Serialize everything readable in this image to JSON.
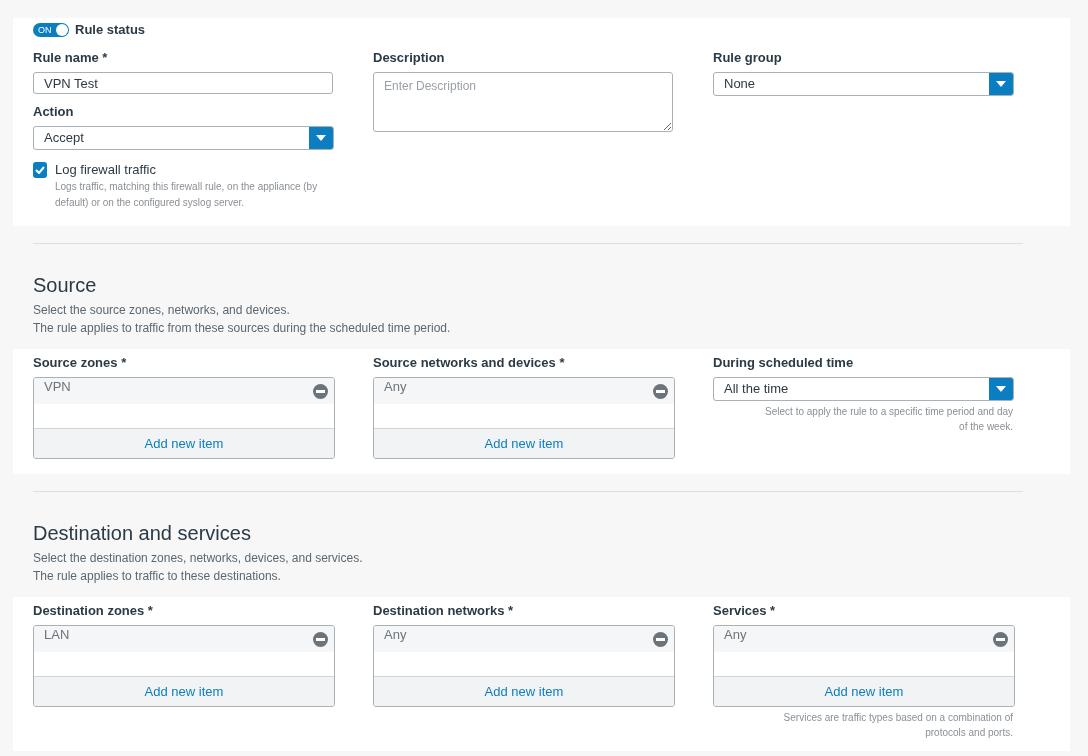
{
  "rule_status": {
    "label": "Rule status",
    "on": true,
    "toggle_text": "ON"
  },
  "rule_name": {
    "label": "Rule name *",
    "value": "VPN Test"
  },
  "action": {
    "label": "Action",
    "value": "Accept"
  },
  "log_traffic": {
    "label": "Log firewall traffic",
    "checked": true,
    "help": "Logs traffic, matching this firewall rule, on the appliance (by default) or on the configured syslog server."
  },
  "description": {
    "label": "Description",
    "placeholder": "Enter Description"
  },
  "rule_group": {
    "label": "Rule group",
    "value": "None"
  },
  "sections": [
    {
      "title": "Source",
      "descriptions": [
        "Select the source zones, networks, and devices.",
        "The rule applies to traffic from these sources during the scheduled time period."
      ],
      "fields": [
        {
          "kind": "list",
          "label": "Source zones *",
          "items": [
            "VPN"
          ],
          "add_label": "Add new item"
        },
        {
          "kind": "list",
          "label": "Source networks and devices *",
          "items": [
            "Any"
          ],
          "add_label": "Add new item"
        },
        {
          "kind": "select",
          "label": "During scheduled time",
          "value": "All the time",
          "help": "Select to apply the rule to a specific time period and day of the week."
        }
      ]
    },
    {
      "title": "Destination and services",
      "descriptions": [
        "Select the destination zones, networks, devices, and services.",
        "The rule applies to traffic to these destinations."
      ],
      "fields": [
        {
          "kind": "list",
          "label": "Destination zones *",
          "items": [
            "LAN"
          ],
          "add_label": "Add new item"
        },
        {
          "kind": "list",
          "label": "Destination networks *",
          "items": [
            "Any"
          ],
          "add_label": "Add new item"
        },
        {
          "kind": "list",
          "label": "Services *",
          "items": [
            "Any"
          ],
          "add_label": "Add new item",
          "help": "Services are traffic types based on a combination of protocols and ports."
        }
      ]
    }
  ]
}
